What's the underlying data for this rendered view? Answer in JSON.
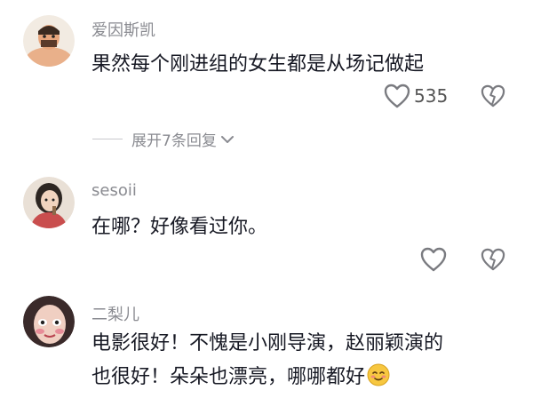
{
  "comments": [
    {
      "username": "爱因斯凯",
      "text": "果然每个刚进组的女生都是从场记做起",
      "likes": "535"
    },
    {
      "username": "sesoii",
      "text": "在哪？好像看过你。"
    },
    {
      "username": "二梨儿",
      "text_line1": "电影很好！不愧是小刚导演，赵丽颖演的",
      "text_line2": "也很好！朵朵也漂亮，哪哪都好"
    }
  ],
  "expand_replies": {
    "label": "展开7条回复"
  },
  "icons": {
    "like": "heart-outline-icon",
    "dislike": "broken-heart-icon",
    "expand": "chevron-down-icon",
    "emoji": "smiling-face-emoji"
  },
  "colors": {
    "text": "#161823",
    "muted": "#8a8b91"
  }
}
